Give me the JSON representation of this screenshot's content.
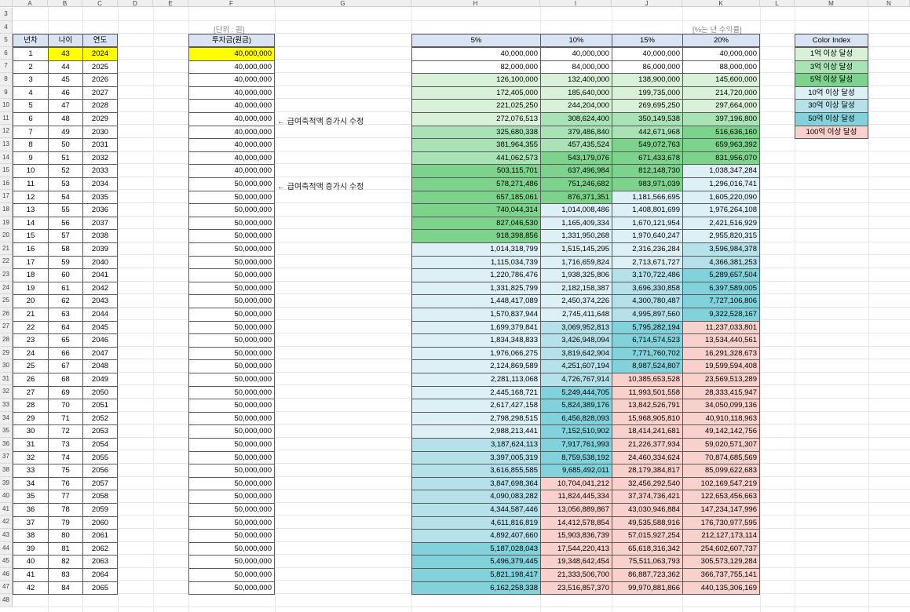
{
  "columns": [
    "A",
    "B",
    "C",
    "D",
    "E",
    "F",
    "G",
    "H",
    "I",
    "J",
    "K",
    "L",
    "M",
    "N"
  ],
  "first_row": 3,
  "last_row": 48,
  "units": {
    "won": "[단위 : 원]",
    "rate": "[%는 년 수익률]"
  },
  "headers": {
    "year_idx": "년차",
    "age": "나이",
    "year": "연도",
    "invest": "투자금(원금)"
  },
  "rate_headers": [
    "5%",
    "10%",
    "15%",
    "20%"
  ],
  "notes": {
    "note1": "← 급여축적액 증가시 수정",
    "note2": "← 급여축적액 증가시 수정"
  },
  "colors": {
    "highlight": "#ffff00",
    "header": "#dae3f3"
  },
  "legend_title": "Color Index",
  "legend": [
    {
      "label": "1억 이상 달성",
      "color": "#d9f1d9"
    },
    {
      "label": "3억 이상 달성",
      "color": "#a9e3b5"
    },
    {
      "label": "5억 이상 달성",
      "color": "#7dd38b"
    },
    {
      "label": "10억 이상 달성",
      "color": "#dcf0f5"
    },
    {
      "label": "30억 이상 달성",
      "color": "#b4e1ea"
    },
    {
      "label": "50억 이상 달성",
      "color": "#82d2dc"
    },
    {
      "label": "100억 이상 달성",
      "color": "#f8d0cc"
    }
  ],
  "rows": [
    {
      "n": "1",
      "age": "43",
      "year": "2024",
      "invest": "40,000,000",
      "r5": "40,000,000",
      "r10": "40,000,000",
      "r15": "40,000,000",
      "r20": "40,000,000"
    },
    {
      "n": "2",
      "age": "44",
      "year": "2025",
      "invest": "40,000,000",
      "r5": "82,000,000",
      "r10": "84,000,000",
      "r15": "86,000,000",
      "r20": "88,000,000"
    },
    {
      "n": "3",
      "age": "45",
      "year": "2026",
      "invest": "40,000,000",
      "r5": "126,100,000",
      "r10": "132,400,000",
      "r15": "138,900,000",
      "r20": "145,600,000"
    },
    {
      "n": "4",
      "age": "46",
      "year": "2027",
      "invest": "40,000,000",
      "r5": "172,405,000",
      "r10": "185,640,000",
      "r15": "199,735,000",
      "r20": "214,720,000"
    },
    {
      "n": "5",
      "age": "47",
      "year": "2028",
      "invest": "40,000,000",
      "r5": "221,025,250",
      "r10": "244,204,000",
      "r15": "269,695,250",
      "r20": "297,664,000"
    },
    {
      "n": "6",
      "age": "48",
      "year": "2029",
      "invest": "40,000,000",
      "r5": "272,076,513",
      "r10": "308,624,400",
      "r15": "350,149,538",
      "r20": "397,196,800"
    },
    {
      "n": "7",
      "age": "49",
      "year": "2030",
      "invest": "40,000,000",
      "r5": "325,680,338",
      "r10": "379,486,840",
      "r15": "442,671,968",
      "r20": "516,636,160"
    },
    {
      "n": "8",
      "age": "50",
      "year": "2031",
      "invest": "40,000,000",
      "r5": "381,964,355",
      "r10": "457,435,524",
      "r15": "549,072,763",
      "r20": "659,963,392"
    },
    {
      "n": "9",
      "age": "51",
      "year": "2032",
      "invest": "40,000,000",
      "r5": "441,062,573",
      "r10": "543,179,076",
      "r15": "671,433,678",
      "r20": "831,956,070"
    },
    {
      "n": "10",
      "age": "52",
      "year": "2033",
      "invest": "40,000,000",
      "r5": "503,115,701",
      "r10": "637,496,984",
      "r15": "812,148,730",
      "r20": "1,038,347,284"
    },
    {
      "n": "11",
      "age": "53",
      "year": "2034",
      "invest": "50,000,000",
      "r5": "578,271,486",
      "r10": "751,246,682",
      "r15": "983,971,039",
      "r20": "1,296,016,741"
    },
    {
      "n": "12",
      "age": "54",
      "year": "2035",
      "invest": "50,000,000",
      "r5": "657,185,061",
      "r10": "876,371,351",
      "r15": "1,181,566,695",
      "r20": "1,605,220,090"
    },
    {
      "n": "13",
      "age": "55",
      "year": "2036",
      "invest": "50,000,000",
      "r5": "740,044,314",
      "r10": "1,014,008,486",
      "r15": "1,408,801,699",
      "r20": "1,976,264,108"
    },
    {
      "n": "14",
      "age": "56",
      "year": "2037",
      "invest": "50,000,000",
      "r5": "827,046,530",
      "r10": "1,165,409,334",
      "r15": "1,670,121,954",
      "r20": "2,421,516,929"
    },
    {
      "n": "15",
      "age": "57",
      "year": "2038",
      "invest": "50,000,000",
      "r5": "918,398,856",
      "r10": "1,331,950,268",
      "r15": "1,970,640,247",
      "r20": "2,955,820,315"
    },
    {
      "n": "16",
      "age": "58",
      "year": "2039",
      "invest": "50,000,000",
      "r5": "1,014,318,799",
      "r10": "1,515,145,295",
      "r15": "2,316,236,284",
      "r20": "3,596,984,378"
    },
    {
      "n": "17",
      "age": "59",
      "year": "2040",
      "invest": "50,000,000",
      "r5": "1,115,034,739",
      "r10": "1,716,659,824",
      "r15": "2,713,671,727",
      "r20": "4,366,381,253"
    },
    {
      "n": "18",
      "age": "60",
      "year": "2041",
      "invest": "50,000,000",
      "r5": "1,220,786,476",
      "r10": "1,938,325,806",
      "r15": "3,170,722,486",
      "r20": "5,289,657,504"
    },
    {
      "n": "19",
      "age": "61",
      "year": "2042",
      "invest": "50,000,000",
      "r5": "1,331,825,799",
      "r10": "2,182,158,387",
      "r15": "3,696,330,858",
      "r20": "6,397,589,005"
    },
    {
      "n": "20",
      "age": "62",
      "year": "2043",
      "invest": "50,000,000",
      "r5": "1,448,417,089",
      "r10": "2,450,374,226",
      "r15": "4,300,780,487",
      "r20": "7,727,106,806"
    },
    {
      "n": "21",
      "age": "63",
      "year": "2044",
      "invest": "50,000,000",
      "r5": "1,570,837,944",
      "r10": "2,745,411,648",
      "r15": "4,995,897,560",
      "r20": "9,322,528,167"
    },
    {
      "n": "22",
      "age": "64",
      "year": "2045",
      "invest": "50,000,000",
      "r5": "1,699,379,841",
      "r10": "3,069,952,813",
      "r15": "5,795,282,194",
      "r20": "11,237,033,801"
    },
    {
      "n": "23",
      "age": "65",
      "year": "2046",
      "invest": "50,000,000",
      "r5": "1,834,348,833",
      "r10": "3,426,948,094",
      "r15": "6,714,574,523",
      "r20": "13,534,440,561"
    },
    {
      "n": "24",
      "age": "66",
      "year": "2047",
      "invest": "50,000,000",
      "r5": "1,976,066,275",
      "r10": "3,819,642,904",
      "r15": "7,771,760,702",
      "r20": "16,291,328,673"
    },
    {
      "n": "25",
      "age": "67",
      "year": "2048",
      "invest": "50,000,000",
      "r5": "2,124,869,589",
      "r10": "4,251,607,194",
      "r15": "8,987,524,807",
      "r20": "19,599,594,408"
    },
    {
      "n": "26",
      "age": "68",
      "year": "2049",
      "invest": "50,000,000",
      "r5": "2,281,113,068",
      "r10": "4,726,767,914",
      "r15": "10,385,653,528",
      "r20": "23,569,513,289"
    },
    {
      "n": "27",
      "age": "69",
      "year": "2050",
      "invest": "50,000,000",
      "r5": "2,445,168,721",
      "r10": "5,249,444,705",
      "r15": "11,993,501,558",
      "r20": "28,333,415,947"
    },
    {
      "n": "28",
      "age": "70",
      "year": "2051",
      "invest": "50,000,000",
      "r5": "2,617,427,158",
      "r10": "5,824,389,176",
      "r15": "13,842,526,791",
      "r20": "34,050,099,136"
    },
    {
      "n": "29",
      "age": "71",
      "year": "2052",
      "invest": "50,000,000",
      "r5": "2,798,298,515",
      "r10": "6,456,828,093",
      "r15": "15,968,905,810",
      "r20": "40,910,118,963"
    },
    {
      "n": "30",
      "age": "72",
      "year": "2053",
      "invest": "50,000,000",
      "r5": "2,988,213,441",
      "r10": "7,152,510,902",
      "r15": "18,414,241,681",
      "r20": "49,142,142,756"
    },
    {
      "n": "31",
      "age": "73",
      "year": "2054",
      "invest": "50,000,000",
      "r5": "3,187,624,113",
      "r10": "7,917,761,993",
      "r15": "21,226,377,934",
      "r20": "59,020,571,307"
    },
    {
      "n": "32",
      "age": "74",
      "year": "2055",
      "invest": "50,000,000",
      "r5": "3,397,005,319",
      "r10": "8,759,538,192",
      "r15": "24,460,334,624",
      "r20": "70,874,685,569"
    },
    {
      "n": "33",
      "age": "75",
      "year": "2056",
      "invest": "50,000,000",
      "r5": "3,616,855,585",
      "r10": "9,685,492,011",
      "r15": "28,179,384,817",
      "r20": "85,099,622,683"
    },
    {
      "n": "34",
      "age": "76",
      "year": "2057",
      "invest": "50,000,000",
      "r5": "3,847,698,364",
      "r10": "10,704,041,212",
      "r15": "32,456,292,540",
      "r20": "102,169,547,219"
    },
    {
      "n": "35",
      "age": "77",
      "year": "2058",
      "invest": "50,000,000",
      "r5": "4,090,083,282",
      "r10": "11,824,445,334",
      "r15": "37,374,736,421",
      "r20": "122,653,456,663"
    },
    {
      "n": "36",
      "age": "78",
      "year": "2059",
      "invest": "50,000,000",
      "r5": "4,344,587,446",
      "r10": "13,056,889,867",
      "r15": "43,030,946,884",
      "r20": "147,234,147,996"
    },
    {
      "n": "37",
      "age": "79",
      "year": "2060",
      "invest": "50,000,000",
      "r5": "4,611,816,819",
      "r10": "14,412,578,854",
      "r15": "49,535,588,916",
      "r20": "176,730,977,595"
    },
    {
      "n": "38",
      "age": "80",
      "year": "2061",
      "invest": "50,000,000",
      "r5": "4,892,407,660",
      "r10": "15,903,836,739",
      "r15": "57,015,927,254",
      "r20": "212,127,173,114"
    },
    {
      "n": "39",
      "age": "81",
      "year": "2062",
      "invest": "50,000,000",
      "r5": "5,187,028,043",
      "r10": "17,544,220,413",
      "r15": "65,618,316,342",
      "r20": "254,602,607,737"
    },
    {
      "n": "40",
      "age": "82",
      "year": "2063",
      "invest": "50,000,000",
      "r5": "5,496,379,445",
      "r10": "19,348,642,454",
      "r15": "75,511,063,793",
      "r20": "305,573,129,284"
    },
    {
      "n": "41",
      "age": "83",
      "year": "2064",
      "invest": "50,000,000",
      "r5": "5,821,198,417",
      "r10": "21,333,506,700",
      "r15": "86,887,723,362",
      "r20": "366,737,755,141"
    },
    {
      "n": "42",
      "age": "84",
      "year": "2065",
      "invest": "50,000,000",
      "r5": "6,162,258,338",
      "r10": "23,516,857,370",
      "r15": "99,970,881,866",
      "r20": "440,135,306,169"
    }
  ]
}
